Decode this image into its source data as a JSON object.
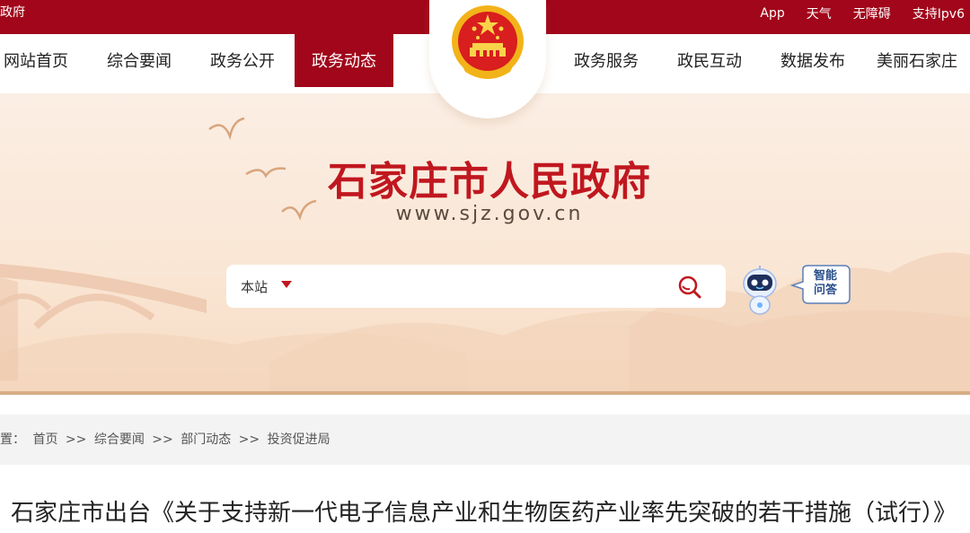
{
  "topbar": {
    "site_name": "政府",
    "links": [
      "App",
      "天气",
      "无障碍",
      "支持Ipv6"
    ]
  },
  "nav": {
    "items": [
      "网站首页",
      "综合要闻",
      "政务公开",
      "政务动态",
      "政务服务",
      "政民互动",
      "数据发布",
      "美丽石家庄"
    ],
    "active": "政务动态"
  },
  "banner": {
    "title": "石家庄市人民政府",
    "url": "www.sjz.gov.cn"
  },
  "search": {
    "scope": "本站",
    "value": "",
    "placeholder": ""
  },
  "assistant": {
    "label_line1": "智能",
    "label_line2": "问答"
  },
  "breadcrumb": {
    "prefix": "位置：",
    "items": [
      "首页",
      "综合要闻",
      "部门动态",
      "投资促进局"
    ],
    "separator": ">>"
  },
  "article": {
    "title": "石家庄市出台《关于支持新一代电子信息产业和生物医药产业率先突破的若干措施（试行）》"
  },
  "colors": {
    "brand_red": "#a1061a",
    "title_red": "#c0171f",
    "banner_bg": "#fae7d6"
  }
}
